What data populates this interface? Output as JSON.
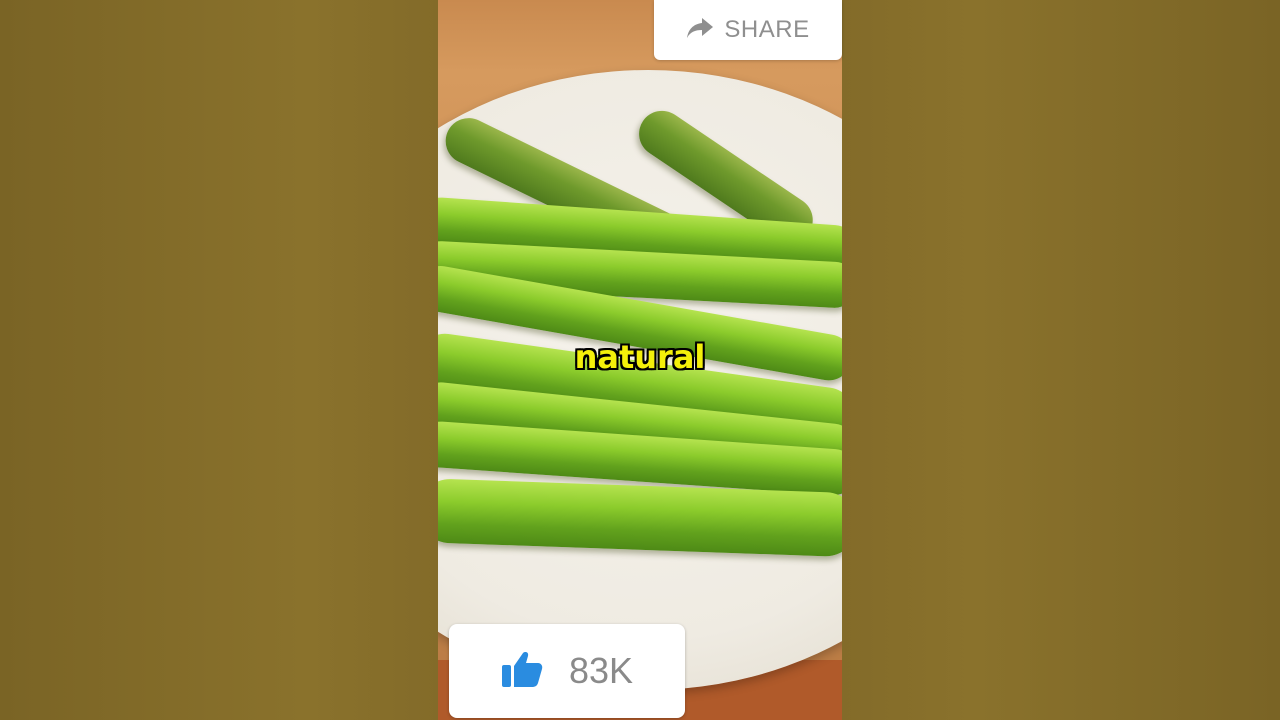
{
  "caption": {
    "text": "natural"
  },
  "share_button": {
    "label": "SHARE",
    "icon": "share-arrow-icon"
  },
  "like_button": {
    "count": "83K",
    "icon": "thumbs-up-icon"
  },
  "colors": {
    "caption_text": "#f4f00a",
    "like_icon": "#2a8ce0",
    "button_text": "#8a8a8a"
  }
}
